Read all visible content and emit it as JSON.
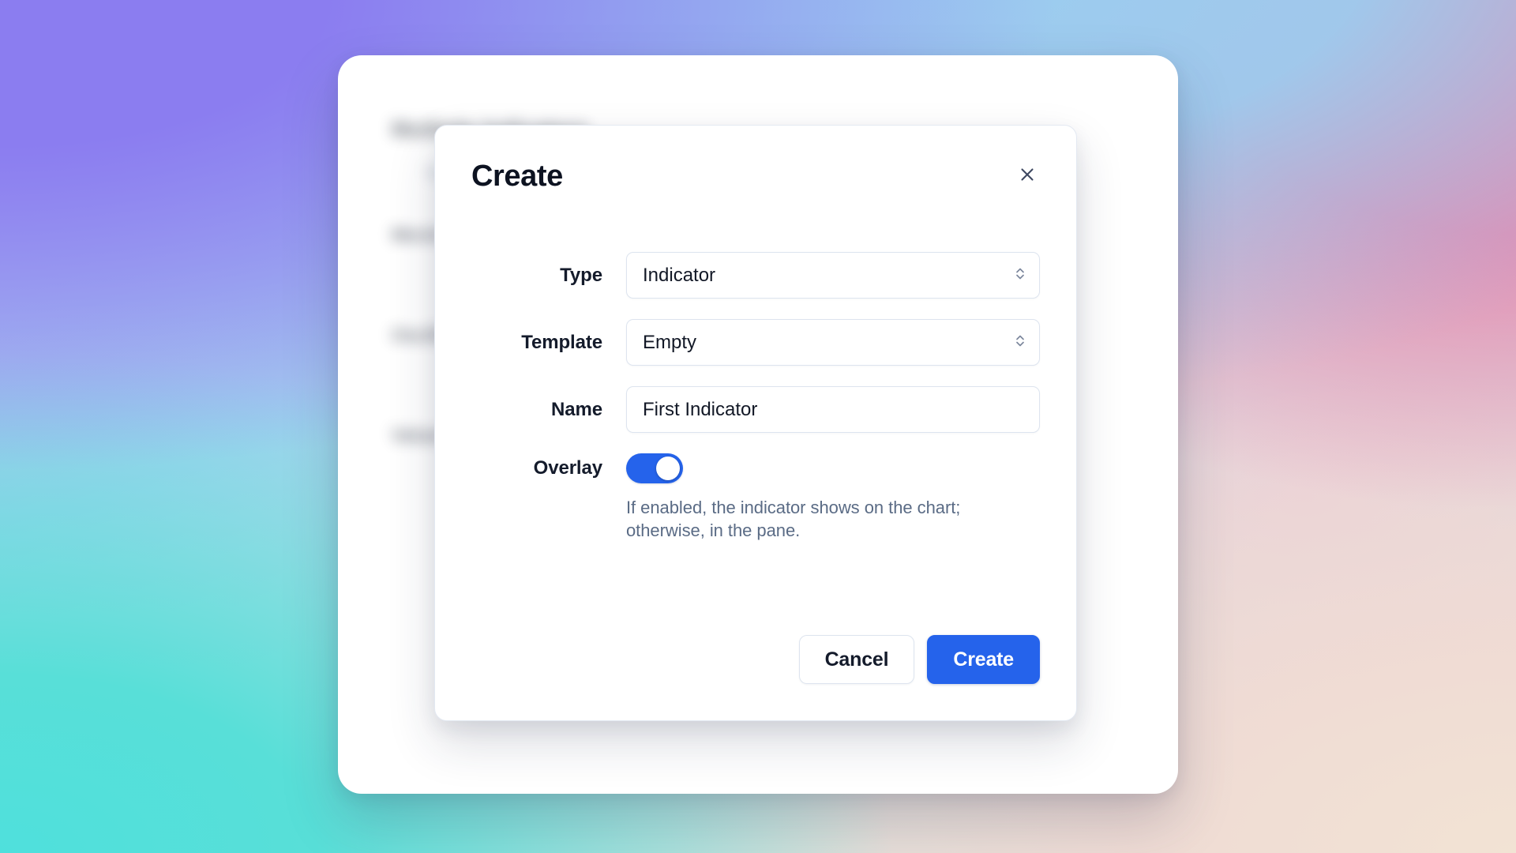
{
  "background": {
    "gradient": {
      "top_left": "#8B7DF0",
      "top_center": "#9BCDF0",
      "top_right": "#E585AD",
      "bottom_left": "#4FE0DC",
      "bottom_right": "#F2E3D4"
    },
    "app_card": {
      "heading": "Multiple Indicators",
      "subtitle": "Templates",
      "sections": [
        {
          "label": "Moving Averages"
        },
        {
          "label": "Oscillators"
        },
        {
          "label": "Volume"
        }
      ]
    }
  },
  "modal": {
    "title": "Create",
    "close_icon": "close-icon",
    "fields": {
      "type": {
        "label": "Type",
        "value": "Indicator",
        "icon": "selector-chevron-icon"
      },
      "template": {
        "label": "Template",
        "value": "Empty",
        "icon": "selector-chevron-icon"
      },
      "name": {
        "label": "Name",
        "value": "First Indicator",
        "placeholder": "Name"
      },
      "overlay": {
        "label": "Overlay",
        "enabled": true,
        "help_text": "If enabled, the indicator shows on the chart; otherwise, in the pane."
      }
    },
    "footer": {
      "cancel_label": "Cancel",
      "create_label": "Create"
    },
    "colors": {
      "accent": "#2563EB",
      "title": "#0D1321",
      "help_text": "#5A6B85",
      "border": "#DDE4EF"
    }
  }
}
